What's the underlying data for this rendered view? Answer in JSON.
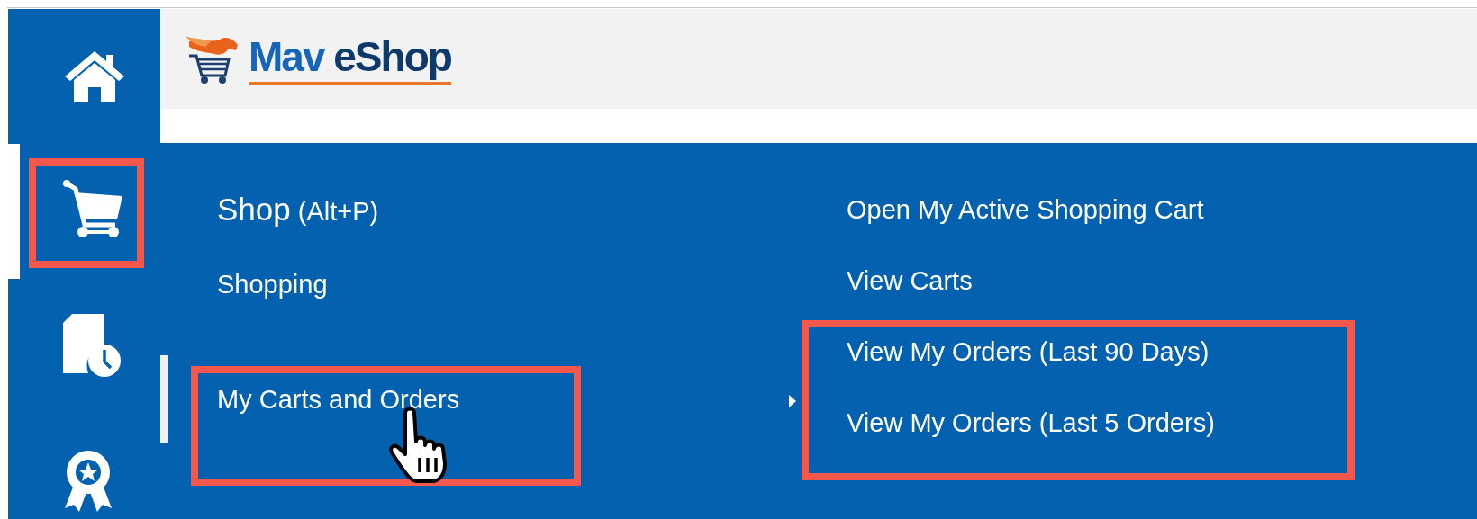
{
  "sidebar": {
    "items": [
      {
        "kind": "home",
        "selected": false,
        "highlighted": false
      },
      {
        "kind": "cart",
        "selected": true,
        "highlighted": true
      },
      {
        "kind": "history",
        "selected": false,
        "highlighted": false
      },
      {
        "kind": "award",
        "selected": false,
        "highlighted": false
      }
    ]
  },
  "header": {
    "logo": {
      "words": [
        "Mav",
        "eShop"
      ]
    }
  },
  "menu": {
    "heading": {
      "title": "Shop",
      "shortcut": "(Alt+P)"
    },
    "items": [
      {
        "label": "Shopping",
        "hovered": false,
        "highlighted": false
      },
      {
        "label": "My Carts and Orders",
        "hovered": true,
        "highlighted": true
      }
    ],
    "submenu": {
      "items": [
        {
          "label": "Open My Active Shopping Cart",
          "highlighted": false
        },
        {
          "label": "View Carts",
          "highlighted": false
        },
        {
          "label": "View My Orders (Last 90 Days)",
          "highlighted": true
        },
        {
          "label": "View My Orders (Last 5 Orders)",
          "highlighted": true
        }
      ]
    }
  },
  "cursor": {
    "kind": "hand"
  }
}
